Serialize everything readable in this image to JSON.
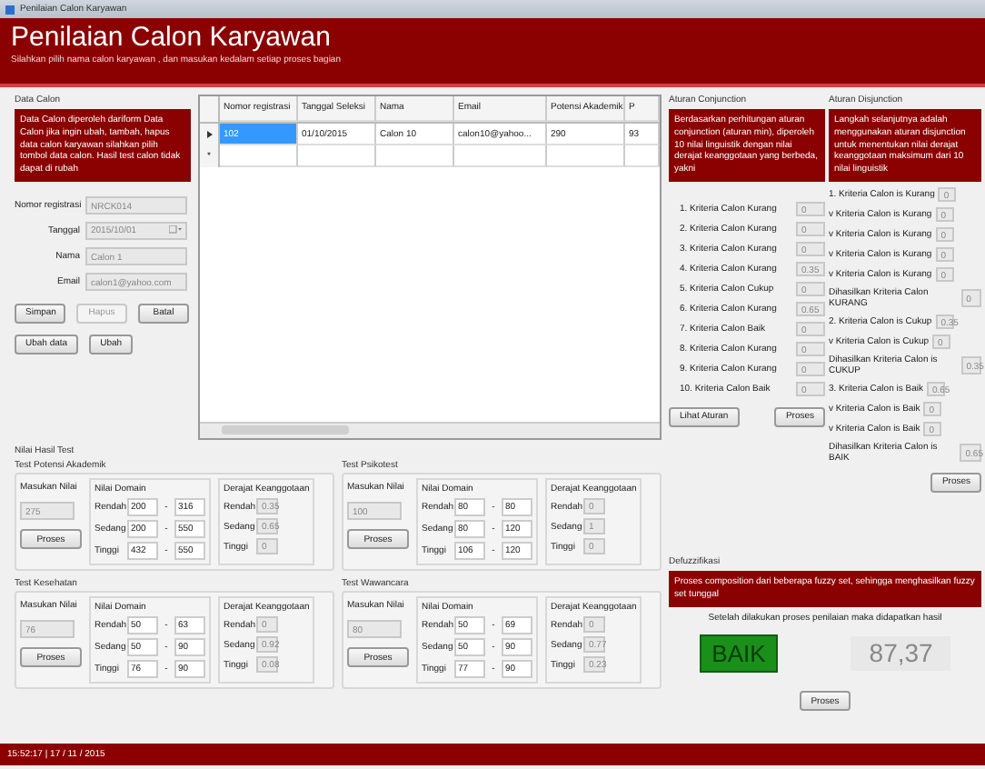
{
  "window": {
    "title": "Penilaian Calon Karyawan"
  },
  "header": {
    "title": "Penilaian Calon Karyawan",
    "subtitle": "Silahkan pilih nama calon karyawan , dan masukan kedalam setiap proses bagian"
  },
  "data_calon": {
    "title": "Data Calon",
    "info": "Data Calon diperoleh dariform Data Calon jika ingin ubah, tambah, hapus data calon karyawan silahkan pilih tombol data calon. Hasil test calon tidak dapat di rubah",
    "fields": [
      {
        "label": "Nomor registrasi",
        "value": "NRCK014",
        "kind": "text"
      },
      {
        "label": "Tanggal",
        "value": "2015/10/01",
        "kind": "date"
      },
      {
        "label": "Nama",
        "value": "Calon 1",
        "kind": "text"
      },
      {
        "label": "Email",
        "value": "calon1@yahoo.com",
        "kind": "text"
      }
    ],
    "buttons": [
      {
        "label": "Simpan",
        "disabled": false
      },
      {
        "label": "Hapus",
        "disabled": true
      },
      {
        "label": "Batal",
        "disabled": false
      }
    ],
    "edit_buttons": [
      {
        "label": "Ubah data"
      },
      {
        "label": "Ubah"
      }
    ]
  },
  "table": {
    "columns": [
      "Nomor registrasi",
      "Tanggal Seleksi",
      "Nama",
      "Email",
      "Potensi Akademik",
      "P"
    ],
    "rows": [
      {
        "cells": [
          "102",
          "01/10/2015",
          "Calon 10",
          "calon10@yahoo...",
          "290",
          "93"
        ],
        "selected": true
      }
    ],
    "new_row": {
      "marker": "*"
    }
  },
  "nilai_hasil_test": {
    "title": "Nilai Hasil Test",
    "groups": [
      {
        "title": "Test Potensi Akademik",
        "input_label": "Masukan Nilai",
        "input_value": "275",
        "button": "Proses",
        "domain_title": "Nilai Domain",
        "domain": [
          {
            "label": "Rendah",
            "from": "200",
            "separator": "-",
            "to": "316"
          },
          {
            "label": "Sedang",
            "from": "200",
            "separator": "-",
            "to": "550"
          },
          {
            "label": "Tinggi",
            "from": "432",
            "separator": "-",
            "to": "550"
          }
        ],
        "degree_title": "Derajat Keanggotaan",
        "degrees": [
          {
            "label": "Rendah",
            "value": "0.35"
          },
          {
            "label": "Sedang",
            "value": "0.65"
          },
          {
            "label": "Tinggi",
            "value": "0"
          }
        ]
      },
      {
        "title": "Test Psikotest",
        "input_label": "Masukan Nilai",
        "input_value": "100",
        "button": "Proses",
        "domain_title": "Nilai Domain",
        "domain": [
          {
            "label": "Rendah",
            "from": "80",
            "separator": "-",
            "to": "80"
          },
          {
            "label": "Sedang",
            "from": "80",
            "separator": "-",
            "to": "120"
          },
          {
            "label": "Tinggi",
            "from": "106",
            "separator": "-",
            "to": "120"
          }
        ],
        "degree_title": "Derajat Keanggotaan",
        "degrees": [
          {
            "label": "Rendah",
            "value": "0"
          },
          {
            "label": "Sedang",
            "value": "1"
          },
          {
            "label": "Tinggi",
            "value": "0"
          }
        ]
      },
      {
        "title": "Test Kesehatan",
        "input_label": "Masukan Nilai",
        "input_value": "76",
        "button": "Proses",
        "domain_title": "Nilai Domain",
        "domain": [
          {
            "label": "Rendah",
            "from": "50",
            "separator": "-",
            "to": "63"
          },
          {
            "label": "Sedang",
            "from": "50",
            "separator": "-",
            "to": "90"
          },
          {
            "label": "Tinggi",
            "from": "76",
            "separator": "-",
            "to": "90"
          }
        ],
        "degree_title": "Derajat Keanggotaan",
        "degrees": [
          {
            "label": "Rendah",
            "value": "0"
          },
          {
            "label": "Sedang",
            "value": "0.92"
          },
          {
            "label": "Tinggi",
            "value": "0.08"
          }
        ]
      },
      {
        "title": "Test Wawancara",
        "input_label": "Masukan Nilai",
        "input_value": "80",
        "button": "Proses",
        "domain_title": "Nilai Domain",
        "domain": [
          {
            "label": "Rendah",
            "from": "50",
            "separator": "-",
            "to": "69"
          },
          {
            "label": "Sedang",
            "from": "50",
            "separator": "-",
            "to": "90"
          },
          {
            "label": "Tinggi",
            "from": "77",
            "separator": "-",
            "to": "90"
          }
        ],
        "degree_title": "Derajat Keanggotaan",
        "degrees": [
          {
            "label": "Rendah",
            "value": "0"
          },
          {
            "label": "Sedang",
            "value": "0.77"
          },
          {
            "label": "Tinggi",
            "value": "0.23"
          }
        ]
      }
    ]
  },
  "conjunction": {
    "title": "Aturan Conjunction",
    "info": "Berdasarkan perhitungan aturan conjunction (aturan min), diperoleh 10 nilai linguistik dengan nilai derajat keanggotaan yang berbeda, yakni",
    "items": [
      {
        "label": "1. Kriteria Calon Kurang",
        "value": "0"
      },
      {
        "label": "2. Kriteria Calon Kurang",
        "value": "0"
      },
      {
        "label": "3. Kriteria Calon Kurang",
        "value": "0"
      },
      {
        "label": "4. Kriteria Calon Kurang",
        "value": "0.35"
      },
      {
        "label": "5. Kriteria Calon Cukup",
        "value": "0"
      },
      {
        "label": "6. Kriteria Calon Kurang",
        "value": "0.65"
      },
      {
        "label": "7. Kriteria Calon Baik",
        "value": "0"
      },
      {
        "label": "8. Kriteria Calon Kurang",
        "value": "0"
      },
      {
        "label": "9. Kriteria Calon Kurang",
        "value": "0"
      },
      {
        "label": "10. Kriteria Calon Baik",
        "value": "0"
      }
    ],
    "buttons": [
      "Lihat Aturan",
      "Proses"
    ]
  },
  "disjunction": {
    "title": "Aturan Disjunction",
    "info": "Langkah selanjutnya adalah menggunakan aturan disjunction untuk menentukan nilai derajat keanggotaan maksimum dari 10 nilai linguistik",
    "rules": [
      {
        "terms": [
          {
            "text": "1. Kriteria Calon is Kurang",
            "value": "0"
          },
          {
            "text": "v Kriteria Calon is Kurang",
            "value": "0"
          },
          {
            "text": "v Kriteria Calon is Kurang",
            "value": "0"
          },
          {
            "text": "v Kriteria Calon is Kurang",
            "value": "0"
          },
          {
            "text": "v Kriteria Calon is Kurang",
            "value": "0"
          }
        ],
        "result_label": "Dihasilkan Kriteria Calon KURANG",
        "result_value": "0"
      },
      {
        "terms": [
          {
            "text": "2. Kriteria Calon is Cukup",
            "value": "0.35"
          },
          {
            "text": "v Kriteria Calon is Cukup",
            "value": "0"
          }
        ],
        "result_label": "Dihasilkan Kriteria Calon is CUKUP",
        "result_value": "0.35"
      },
      {
        "terms": [
          {
            "text": "3. Kriteria Calon is Baik",
            "value": "0.65"
          },
          {
            "text": "v Kriteria Calon is Baik",
            "value": "0"
          },
          {
            "text": "v Kriteria Calon is Baik",
            "value": "0"
          }
        ],
        "result_label": "Dihasilkan Kriteria Calon is BAIK",
        "result_value": "0.65"
      }
    ],
    "button": "Proses"
  },
  "defuzzifikasi": {
    "title": "Defuzzifikasi",
    "info": "Proses composition dari beberapa fuzzy set, sehingga menghasilkan fuzzy set tunggal",
    "note": "Setelah dilakukan proses penilaian maka didapatkan hasil",
    "result_label": "BAIK",
    "result_value": "87,37",
    "button": "Proses"
  },
  "status_bar": {
    "text": "15:52:17 | 17 / 11 / 2015"
  }
}
